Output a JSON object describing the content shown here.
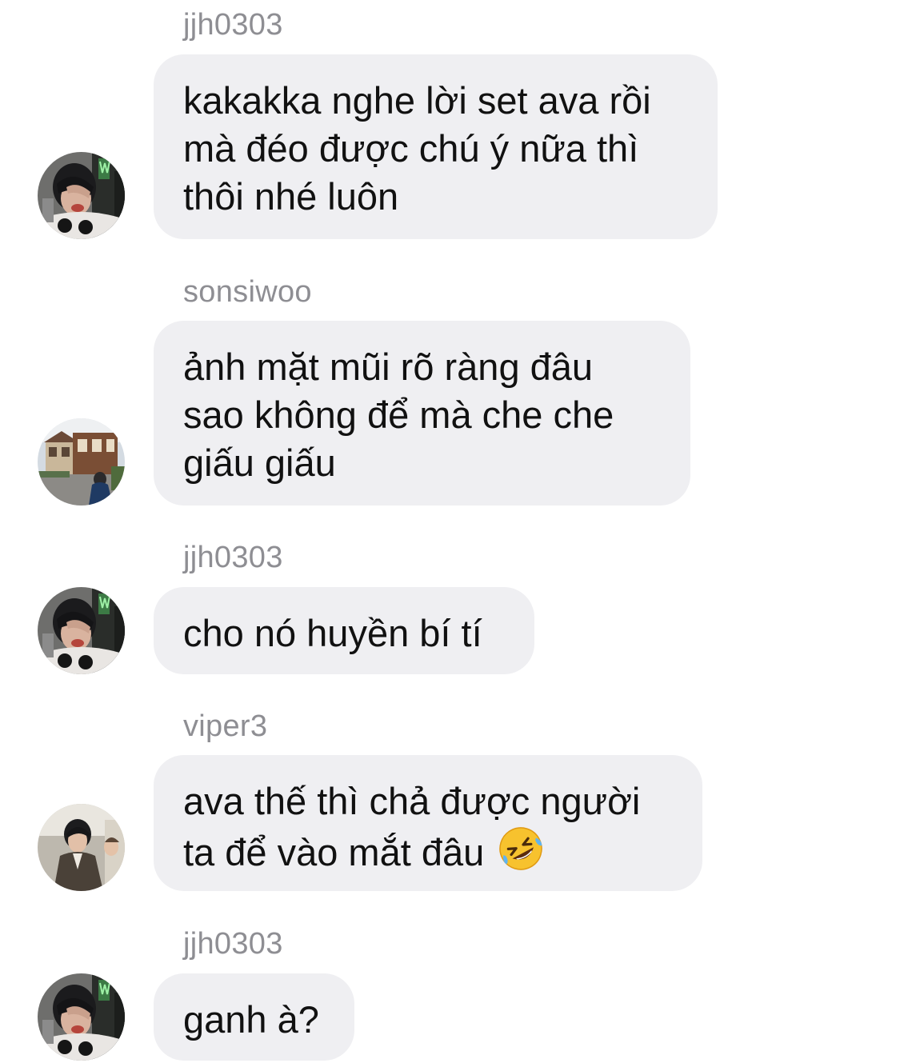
{
  "messages": [
    {
      "sender": "jjh0303",
      "avatar": "user-jjh0303-avatar",
      "lines": [
        "kakakka nghe lời set ava rồi",
        "mà đéo được chú ý nữa thì",
        "thôi nhé luôn"
      ]
    },
    {
      "sender": "sonsiwoo",
      "avatar": "user-sonsiwoo-avatar",
      "lines": [
        "ảnh mặt mũi rõ ràng đâu",
        "sao không để mà che che",
        "giấu giấu"
      ]
    },
    {
      "sender": "jjh0303",
      "avatar": "user-jjh0303-avatar",
      "lines": [
        "cho nó huyền bí tí"
      ]
    },
    {
      "sender": "viper3",
      "avatar": "user-viper3-avatar",
      "lines": [
        "ava thế thì chả được người",
        "ta để vào mắt đâu"
      ],
      "emoji": "rolling-on-floor-laughing-emoji"
    },
    {
      "sender": "jjh0303",
      "avatar": "user-jjh0303-avatar",
      "lines": [
        "ganh à?"
      ]
    }
  ],
  "colors": {
    "bubble": "#efeff2",
    "sender_text": "#8e8e93",
    "message_text": "#111111",
    "background": "#ffffff"
  }
}
